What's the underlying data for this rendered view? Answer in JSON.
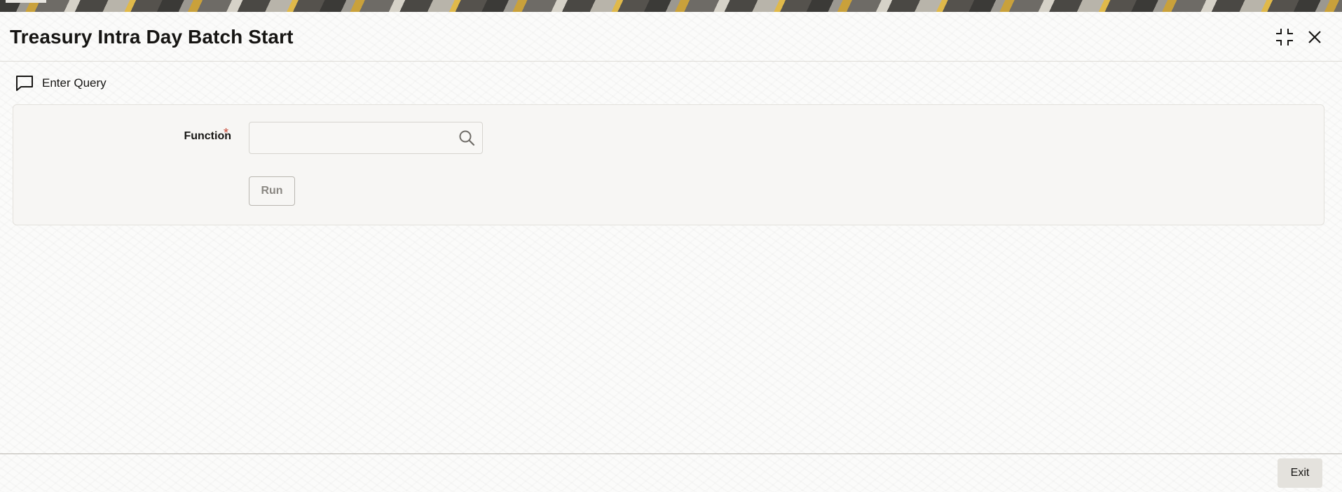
{
  "window": {
    "title": "Treasury Intra Day Batch Start"
  },
  "header_controls": {
    "minimize_icon": "collapse-corners-icon",
    "close_icon": "close-x-icon"
  },
  "toolbar": {
    "enter_query_label": "Enter Query",
    "enter_query_icon": "chat-bubble-icon"
  },
  "form": {
    "function_label": "Function",
    "function_required_mark": "*",
    "function_value": "",
    "function_search_icon": "search-icon",
    "run_label": "Run"
  },
  "footer": {
    "exit_label": "Exit"
  },
  "colors": {
    "required": "#c74634",
    "disabled_text": "#8a8782",
    "text": "#161513"
  }
}
